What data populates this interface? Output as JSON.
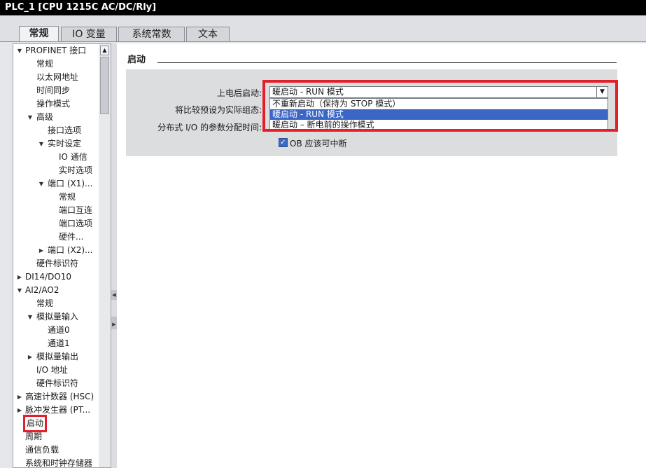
{
  "window": {
    "title": "PLC_1 [CPU 1215C AC/DC/Rly]"
  },
  "tabs": [
    {
      "label": "常规"
    },
    {
      "label": "IO 变量"
    },
    {
      "label": "系统常数"
    },
    {
      "label": "文本"
    }
  ],
  "nav": {
    "items": [
      {
        "label": "PROFINET 接口",
        "arrow": "expanded"
      },
      {
        "label": "常规",
        "arrow": "none"
      },
      {
        "label": "以太网地址",
        "arrow": "none"
      },
      {
        "label": "时间同步",
        "arrow": "none"
      },
      {
        "label": "操作模式",
        "arrow": "none"
      },
      {
        "label": "高级",
        "arrow": "expanded"
      },
      {
        "label": "接口选项",
        "arrow": "none"
      },
      {
        "label": "实时设定",
        "arrow": "expanded"
      },
      {
        "label": "IO 通信",
        "arrow": "none"
      },
      {
        "label": "实时选项",
        "arrow": "none"
      },
      {
        "label": "端口 (X1)...",
        "arrow": "expanded"
      },
      {
        "label": "常规",
        "arrow": "none"
      },
      {
        "label": "端口互连",
        "arrow": "none"
      },
      {
        "label": "端口选项",
        "arrow": "none"
      },
      {
        "label": "硬件...",
        "arrow": "none"
      },
      {
        "label": "端口 (X2)...",
        "arrow": "collapsed"
      },
      {
        "label": "硬件标识符",
        "arrow": "none"
      },
      {
        "label": "DI14/DO10",
        "arrow": "collapsed"
      },
      {
        "label": "AI2/AO2",
        "arrow": "expanded"
      },
      {
        "label": "常规",
        "arrow": "none"
      },
      {
        "label": "模拟量输入",
        "arrow": "expanded"
      },
      {
        "label": "通道0",
        "arrow": "none"
      },
      {
        "label": "通道1",
        "arrow": "none"
      },
      {
        "label": "模拟量输出",
        "arrow": "collapsed"
      },
      {
        "label": "I/O 地址",
        "arrow": "none"
      },
      {
        "label": "硬件标识符",
        "arrow": "none"
      },
      {
        "label": "高速计数器 (HSC)",
        "arrow": "collapsed"
      },
      {
        "label": "脉冲发生器 (PT...",
        "arrow": "collapsed"
      },
      {
        "label": "启动",
        "arrow": "none"
      },
      {
        "label": "周期",
        "arrow": "none"
      },
      {
        "label": "通信负载",
        "arrow": "none"
      },
      {
        "label": "系统和时钟存储器",
        "arrow": "none"
      }
    ]
  },
  "section": {
    "title": "启动"
  },
  "form": {
    "startup_label": "上电后启动:",
    "compare_label": "将比较预设为实际组态:",
    "param_time_label": "分布式 I/O 的参数分配时间:",
    "startup_value": "暖启动 - RUN 模式",
    "options": [
      {
        "label": "不重新启动（保持为 STOP 模式）"
      },
      {
        "label": "暖启动 - RUN 模式"
      },
      {
        "label": "暖启动 – 断电前的操作模式"
      }
    ],
    "ob_interrupt_label": "OB 应该可中断",
    "ob_interrupt_checked": true
  },
  "icons": {
    "expanded": "triangle-down-icon",
    "collapsed": "triangle-right-icon",
    "dropdown": "chevron-down-icon",
    "check": "checkmark-icon"
  },
  "colors": {
    "highlight_red": "#e3202a",
    "selection_blue": "#3a66c6",
    "titlebar": "#000000"
  }
}
